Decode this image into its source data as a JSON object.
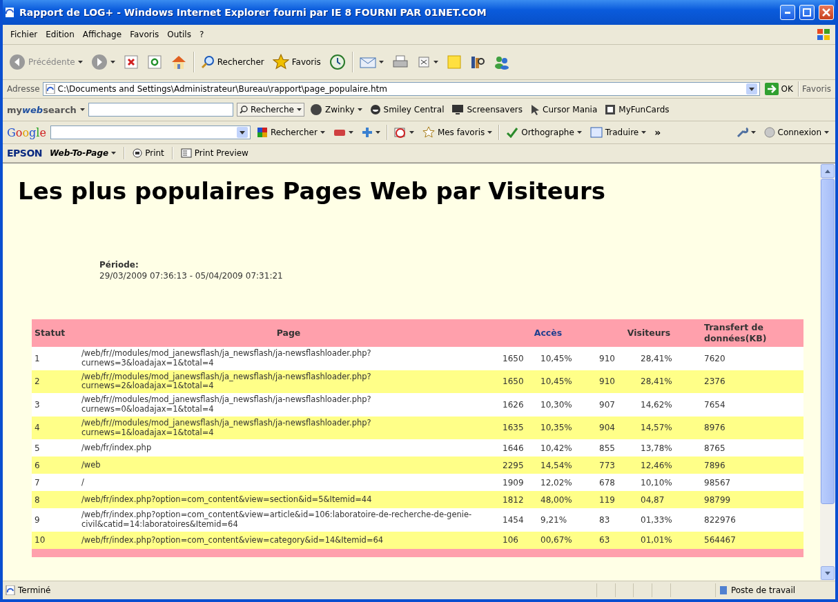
{
  "window": {
    "title": "Rapport de LOG+ - Windows Internet Explorer fourni par IE 8 FOURNI PAR 01NET.COM"
  },
  "menu": [
    "Fichier",
    "Edition",
    "Affichage",
    "Favoris",
    "Outils",
    "?"
  ],
  "toolbar": {
    "back": "Précédente",
    "search": "Rechercher",
    "favorites": "Favoris"
  },
  "address": {
    "label": "Adresse",
    "value": "C:\\Documents and Settings\\Administrateur\\Bureau\\rapport\\page_populaire.htm",
    "go": "OK",
    "links": "Favoris"
  },
  "mywebsearch": {
    "brand": [
      "my",
      "web",
      "search"
    ],
    "search_button": "Recherche",
    "links": [
      "Zwinky",
      "Smiley Central",
      "Screensavers",
      "Cursor Mania",
      "MyFunCards"
    ]
  },
  "google": {
    "logo": "Google",
    "search_button": "Rechercher",
    "favorites": "Mes favoris",
    "spelling": "Orthographe",
    "translate": "Traduire",
    "more": "»",
    "connect": "Connexion"
  },
  "epson": {
    "brand": "EPSON",
    "menu": "Web-To-Page",
    "print": "Print",
    "preview": "Print Preview"
  },
  "page": {
    "heading": "Les plus populaires Pages Web par Visiteurs",
    "period_label": "Période:",
    "period_value": "29/03/2009 07:36:13 - 05/04/2009 07:31:21",
    "table": {
      "columns": [
        {
          "label": "Statut",
          "color": "#333333"
        },
        {
          "label": "Page",
          "color": "#333333"
        },
        {
          "label": "Accès",
          "color": "#1f3f8f"
        },
        {
          "label": "Visiteurs",
          "color": "#333333"
        },
        {
          "label": "Transfert de données(KB)",
          "color": "#333333"
        }
      ],
      "rows": [
        {
          "statut": "1",
          "page": "/web/fr//modules/mod_janewsflash/ja_newsflash/ja-newsflashloader.php? curnews=3&loadajax=1&total=4",
          "acces": {
            "count": "1650",
            "percent": "10,45%"
          },
          "visiteurs": {
            "count": "910",
            "percent": "28,41%"
          },
          "transfert": "7620"
        },
        {
          "statut": "2",
          "page": "/web/fr//modules/mod_janewsflash/ja_newsflash/ja-newsflashloader.php? curnews=2&loadajax=1&total=4",
          "acces": {
            "count": "1650",
            "percent": "10,45%"
          },
          "visiteurs": {
            "count": "910",
            "percent": "28,41%"
          },
          "transfert": "2376"
        },
        {
          "statut": "3",
          "page": "/web/fr//modules/mod_janewsflash/ja_newsflash/ja-newsflashloader.php? curnews=0&loadajax=1&total=4",
          "acces": {
            "count": "1626",
            "percent": "10,30%"
          },
          "visiteurs": {
            "count": "907",
            "percent": "14,62%"
          },
          "transfert": "7654"
        },
        {
          "statut": "4",
          "page": "/web/fr//modules/mod_janewsflash/ja_newsflash/ja-newsflashloader.php? curnews=1&loadajax=1&total=4",
          "acces": {
            "count": "1635",
            "percent": "10,35%"
          },
          "visiteurs": {
            "count": "904",
            "percent": "14,57%"
          },
          "transfert": "8976"
        },
        {
          "statut": "5",
          "page": "/web/fr/index.php",
          "acces": {
            "count": "1646",
            "percent": "10,42%"
          },
          "visiteurs": {
            "count": "855",
            "percent": "13,78%"
          },
          "transfert": "8765"
        },
        {
          "statut": "6",
          "page": "/web",
          "acces": {
            "count": "2295",
            "percent": "14,54%"
          },
          "visiteurs": {
            "count": "773",
            "percent": "12,46%"
          },
          "transfert": "7896"
        },
        {
          "statut": "7",
          "page": "/",
          "acces": {
            "count": "1909",
            "percent": "12,02%"
          },
          "visiteurs": {
            "count": "678",
            "percent": "10,10%"
          },
          "transfert": "98567"
        },
        {
          "statut": "8",
          "page": "/web/fr/index.php?option=com_content&view=section&id=5&Itemid=44",
          "acces": {
            "count": "1812",
            "percent": "48,00%"
          },
          "visiteurs": {
            "count": "119",
            "percent": "04,87"
          },
          "transfert": "98799"
        },
        {
          "statut": "9",
          "page": "/web/fr/index.php?option=com_content&view=article&id=106:laboratoire-de-recherche-de-genie-civil&catid=14:laboratoires&Itemid=64",
          "acces": {
            "count": "1454",
            "percent": "9,21%"
          },
          "visiteurs": {
            "count": "83",
            "percent": "01,33%"
          },
          "transfert": "822976"
        },
        {
          "statut": "10",
          "page": "/web/fr/index.php?option=com_content&view=category&id=14&Itemid=64",
          "acces": {
            "count": "106",
            "percent": "00,67%"
          },
          "visiteurs": {
            "count": "63",
            "percent": "01,01%"
          },
          "transfert": "564467"
        }
      ]
    }
  },
  "status_bar": {
    "text": "Terminé",
    "zone": "Poste de travail"
  }
}
